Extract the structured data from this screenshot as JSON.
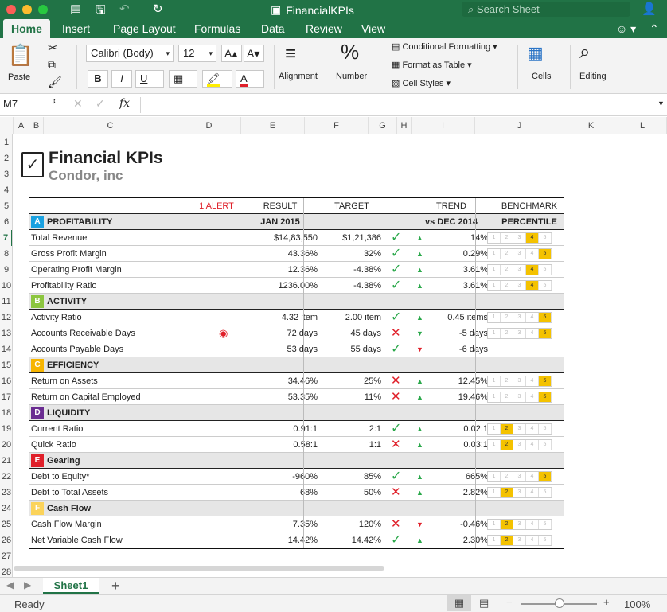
{
  "window": {
    "title": "FinancialKPIs",
    "search_placeholder": "Search Sheet"
  },
  "ribbon_tabs": [
    "Home",
    "Insert",
    "Page Layout",
    "Formulas",
    "Data",
    "Review",
    "View"
  ],
  "ribbon": {
    "paste": "Paste",
    "font": "Calibri (Body)",
    "size": "12",
    "bold": "B",
    "italic": "I",
    "underline": "U",
    "alignment": "Alignment",
    "number": "Number",
    "cond_format": "Conditional Formatting",
    "format_table": "Format as Table",
    "cell_styles": "Cell Styles",
    "cells": "Cells",
    "editing": "Editing"
  },
  "formula": {
    "name_box": "M7",
    "fx": "fx",
    "value": ""
  },
  "columns": [
    "A",
    "B",
    "C",
    "D",
    "E",
    "F",
    "G",
    "H",
    "I",
    "J",
    "K",
    "L"
  ],
  "rows": [
    "1",
    "2",
    "3",
    "4",
    "5",
    "6",
    "7",
    "8",
    "9",
    "10",
    "11",
    "12",
    "13",
    "14",
    "15",
    "16",
    "17",
    "18",
    "19",
    "20",
    "21",
    "22",
    "23",
    "24",
    "25",
    "26",
    "27",
    "28"
  ],
  "sheet": {
    "title": "Financial KPIs",
    "subtitle": "Condor, inc",
    "header": {
      "alert": "1 ALERT",
      "result": "RESULT",
      "target": "TARGET",
      "trend": "TREND",
      "benchmark": "BENCHMARK"
    },
    "subheader": {
      "result": "JAN 2015",
      "trend": "vs DEC 2014",
      "benchmark": "PERCENTILE"
    },
    "sections": [
      {
        "letter": "A",
        "name": "PROFITABILITY",
        "color": "#1aa1e0",
        "rows": [
          {
            "label": "Total Revenue",
            "result": "$14,83,550",
            "target": "$1,21,386",
            "status": "ok",
            "dir": "up",
            "trend": "14%",
            "pct": 4
          },
          {
            "label": "Gross Profit Margin",
            "result": "43.36%",
            "target": "32%",
            "status": "ok",
            "dir": "up",
            "trend": "0.29%",
            "pct": 5
          },
          {
            "label": "Operating Profit Margin",
            "result": "12.36%",
            "target": "-4.38%",
            "status": "ok",
            "dir": "up",
            "trend": "3.61%",
            "pct": 4
          },
          {
            "label": "Profitability Ratio",
            "result": "1236.00%",
            "target": "-4.38%",
            "status": "ok",
            "dir": "up",
            "trend": "3.61%",
            "pct": 4
          }
        ]
      },
      {
        "letter": "B",
        "name": "ACTIVITY",
        "color": "#8cc63f",
        "rows": [
          {
            "label": "Activity Ratio",
            "result": "4.32 item",
            "target": "2.00 item",
            "status": "ok",
            "dir": "up",
            "trend": "0.45 items",
            "pct": 5
          },
          {
            "label": "Accounts Receivable Days",
            "result": "72 days",
            "target": "45 days",
            "status": "bad",
            "dir": "down-green",
            "trend": "-5 days",
            "pct": 5,
            "alert": true
          },
          {
            "label": "Accounts Payable Days",
            "result": "53 days",
            "target": "55 days",
            "status": "ok",
            "dir": "down",
            "trend": "-6 days",
            "pct": 0
          }
        ]
      },
      {
        "letter": "C",
        "name": "EFFICIENCY",
        "color": "#f7b500",
        "rows": [
          {
            "label": "Return on Assets",
            "result": "34.46%",
            "target": "25%",
            "status": "bad",
            "dir": "up",
            "trend": "12.45%",
            "pct": 5
          },
          {
            "label": "Return on Capital Employed",
            "result": "53.35%",
            "target": "11%",
            "status": "bad",
            "dir": "up",
            "trend": "19.46%",
            "pct": 5
          }
        ]
      },
      {
        "letter": "D",
        "name": "LIQUIDITY",
        "color": "#6a2c91",
        "rows": [
          {
            "label": "Current Ratio",
            "result": "0.91:1",
            "target": "2:1",
            "status": "ok",
            "dir": "up",
            "trend": "0.02:1",
            "pct": 2
          },
          {
            "label": "Quick Ratio",
            "result": "0.58:1",
            "target": "1:1",
            "status": "bad",
            "dir": "up",
            "trend": "0.03:1",
            "pct": 2
          }
        ]
      },
      {
        "letter": "E",
        "name": "Gearing",
        "color": "#e0202a",
        "rows": [
          {
            "label": "Debt to Equity*",
            "result": "-960%",
            "target": "85%",
            "status": "ok",
            "dir": "up",
            "trend": "665%",
            "pct": 5
          },
          {
            "label": "Debt to Total Assets",
            "result": "68%",
            "target": "50%",
            "status": "bad",
            "dir": "up",
            "trend": "2.82%",
            "pct": 2
          }
        ]
      },
      {
        "letter": "F",
        "name": "Cash Flow",
        "color": "#fbd35a",
        "rows": [
          {
            "label": "Cash Flow Margin",
            "result": "7.35%",
            "target": "120%",
            "status": "bad",
            "dir": "down",
            "trend": "-0.46%",
            "pct": 2
          },
          {
            "label": "Net Variable Cash Flow",
            "result": "14.42%",
            "target": "14.42%",
            "status": "ok",
            "dir": "up",
            "trend": "2.30%",
            "pct": 2
          }
        ]
      }
    ]
  },
  "sheet_tab": "Sheet1",
  "status": {
    "ready": "Ready",
    "zoom": "100%"
  }
}
